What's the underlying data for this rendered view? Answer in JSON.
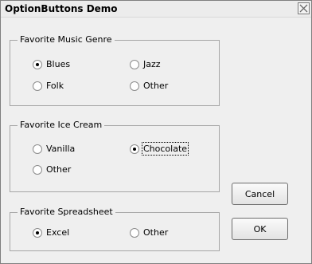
{
  "window": {
    "title": "OptionButtons Demo"
  },
  "music": {
    "legend": "Favorite Music Genre",
    "options": [
      "Blues",
      "Jazz",
      "Folk",
      "Other"
    ]
  },
  "icecream": {
    "legend": "Favorite Ice Cream",
    "options": [
      "Vanilla",
      "Chocolate",
      "Other"
    ]
  },
  "spreadsheet": {
    "legend": "Favorite Spreadsheet",
    "options": [
      "Excel",
      "Other"
    ]
  },
  "buttons": {
    "cancel": "Cancel",
    "ok": "OK"
  }
}
